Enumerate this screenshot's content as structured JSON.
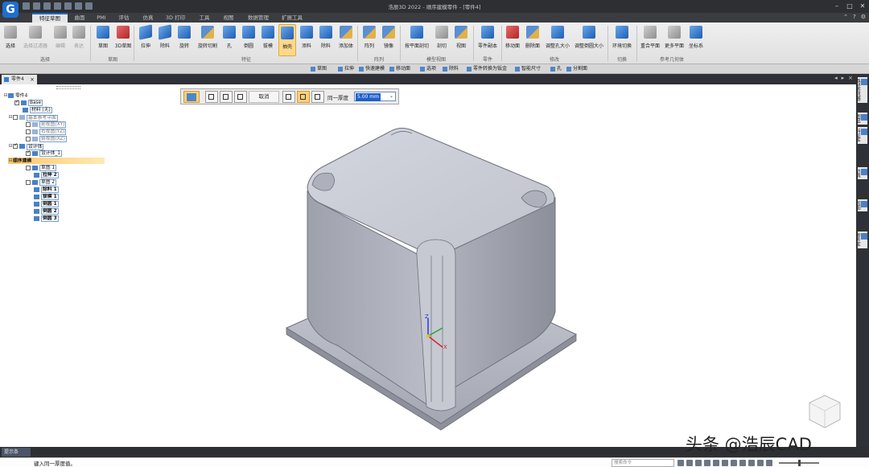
{
  "app": {
    "window_title": "浩辰3D 2022 - 顺序建模零件 - [零件4]",
    "logo_letter": "G"
  },
  "ribbon_tabs": [
    "特征草图",
    "曲面",
    "PMI",
    "评估",
    "仿真",
    "3D 打印",
    "工具",
    "视图",
    "数据管理",
    "扩展工具"
  ],
  "ribbon": {
    "select": "选择",
    "select_filter": "选择过滤器",
    "edit": "编辑",
    "table": "表达",
    "sketch": "草图",
    "sketch_3d": "3D草图",
    "extrude": "拉伸",
    "cut": "除料",
    "revolve": "旋转",
    "revolve_cut": "旋转切割",
    "hole": "孔",
    "chamfer": "倒圆",
    "draft": "拔模",
    "shell": "抽壳",
    "add_material": "添料",
    "remove_material": "除料",
    "add_body": "添加体",
    "array": "阵列",
    "mirror": "镜像",
    "plane_section": "按平面剖切",
    "section": "剖切",
    "view": "视图",
    "part_copy": "零件副本",
    "move_face": "移动面",
    "delete_face": "删除面",
    "resize_hole": "调整孔大小",
    "resize_fillet": "调整倒圆大小",
    "env_switch": "环境切换",
    "coincident_plane": "重合平面",
    "parallel_plane": "更多平面",
    "coord_system": "坐标系",
    "groups": {
      "select": "选择",
      "sketch": "草图",
      "feature": "特征",
      "array": "阵列",
      "model_view": "模型视图",
      "part": "零件",
      "modify": "修改",
      "switch": "切换",
      "ref_geometry": "参考几何体"
    }
  },
  "command_bar": [
    "草图",
    "拉伸",
    "快速建模",
    "移动面",
    "选项",
    "除料",
    "零件转换为钣金",
    "智能尺寸",
    "孔",
    "分割面"
  ],
  "document_tab": "零件4",
  "tree": {
    "root": "零件4",
    "base": "Base",
    "material": "材料 (无)",
    "ref_planes": "基本参考平面",
    "front_plane": "前视图(XY)",
    "right_plane": "右视图(YZ)",
    "top_plane": "俯视图(XZ)",
    "design_body": "设计体",
    "design_body_1": "设计体_1",
    "sequential": "顺序建模",
    "sketch_1": "草图 1",
    "extrude_2": "拉伸 2",
    "sketch_2": "草图 2",
    "cut_1": "除料 1",
    "draft_1": "拔模 1",
    "fillet_1": "倒圆 1",
    "fillet_2": "倒圆 2",
    "fillet_3": "倒圆 3"
  },
  "floatbar": {
    "cancel": "取消",
    "thickness_label": "同一厚度",
    "thickness_value": "5.00 mm"
  },
  "right_panel": [
    "路径查找器",
    "图层",
    "特征库",
    "仿真",
    "视图",
    "零件库"
  ],
  "status": {
    "hint_label": "提示条",
    "prompt": "键入同一厚度值。",
    "search_placeholder": "搜索命令"
  },
  "watermark": "头条 @浩辰CAD",
  "colors": {
    "accent": "#1c6ad6",
    "model_fill": "#b9bcc6",
    "selected": "#ffd07a"
  }
}
